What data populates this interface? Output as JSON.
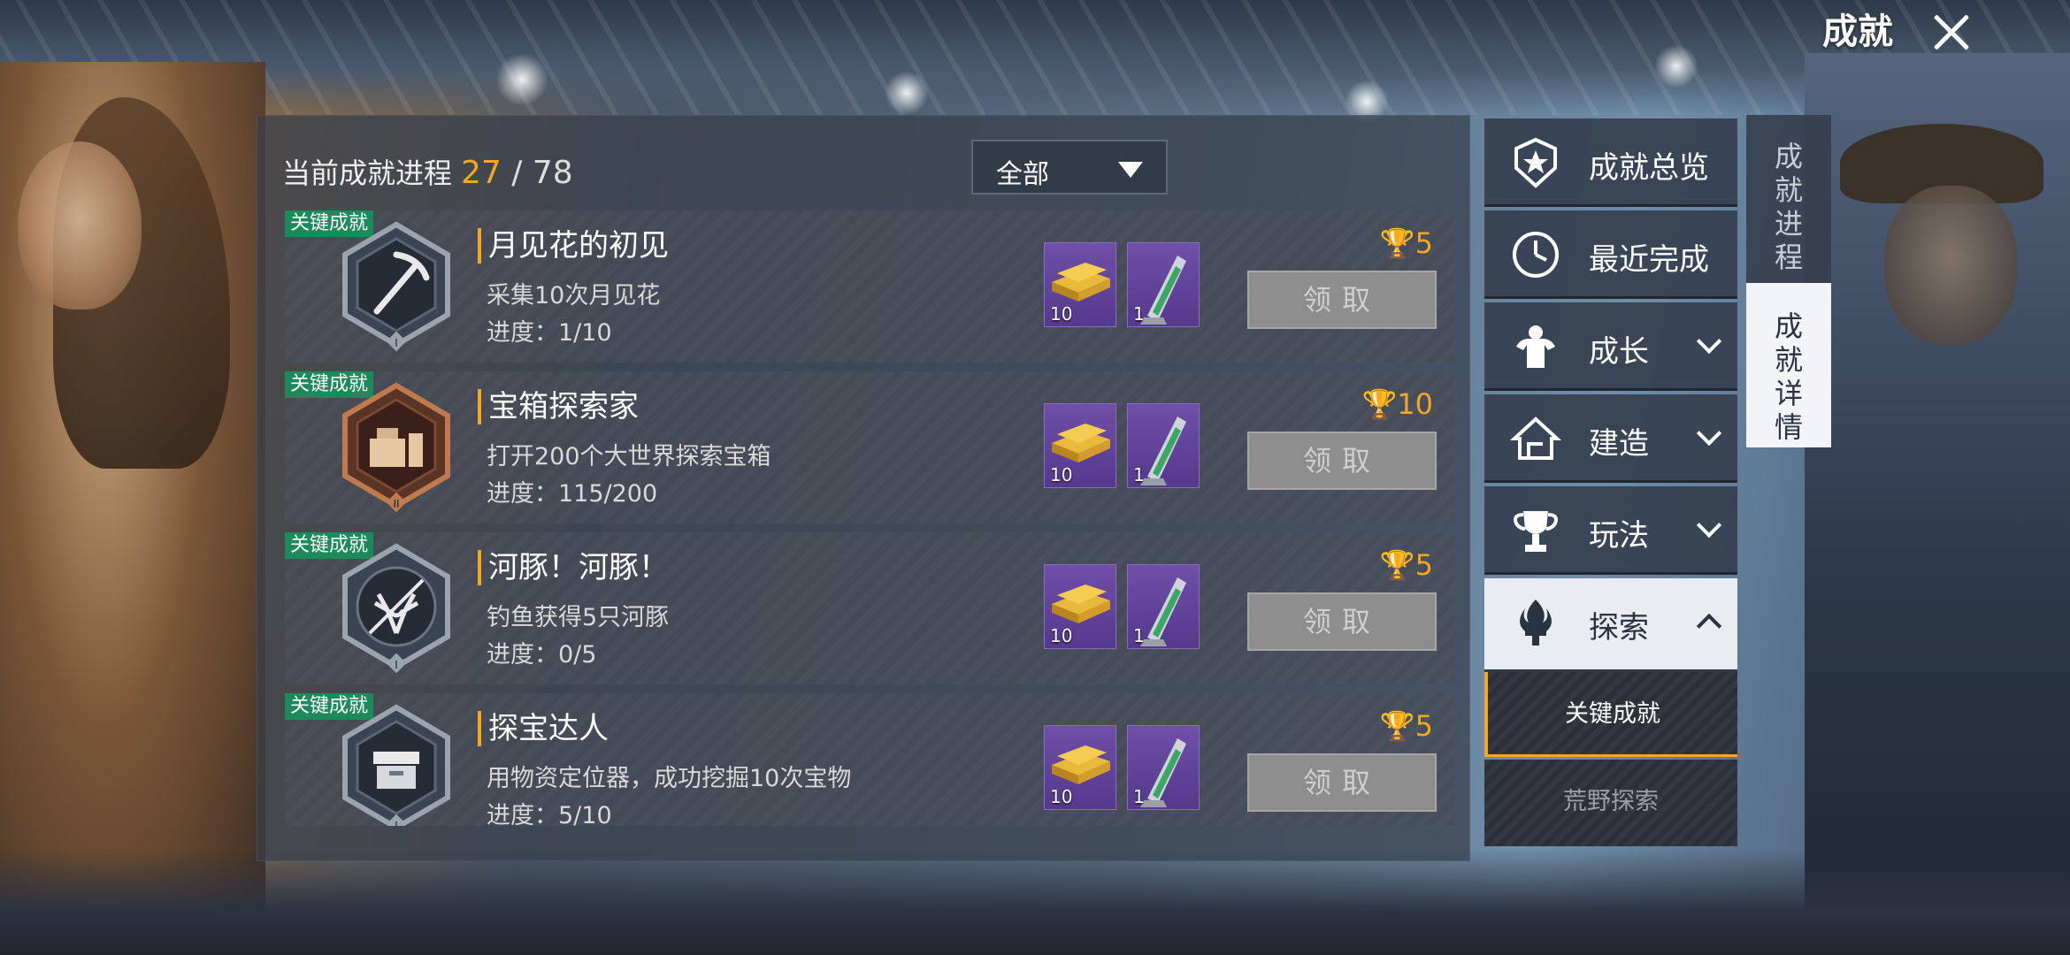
{
  "header": {
    "title": "成就",
    "close_icon": "close-icon"
  },
  "progress": {
    "label": "当前成就进程",
    "current": "27",
    "separator": " / ",
    "total": "78"
  },
  "filter": {
    "selected": "全部",
    "icon": "triangle-down-icon"
  },
  "achievements": [
    {
      "tag": "关键成就",
      "title": "月见花的初见",
      "desc": "采集10次月见花",
      "progress": "进度：1/10",
      "points": "5",
      "reward1_count": "10",
      "reward2_count": "1",
      "claim_label": "领取",
      "badge_icon": "pickaxe-icon",
      "badge_tier": "I"
    },
    {
      "tag": "关键成就",
      "title": "宝箱探索家",
      "desc": "打开200个大世界探索宝箱",
      "progress": "进度：115/200",
      "points": "10",
      "reward1_count": "10",
      "reward2_count": "1",
      "claim_label": "领取",
      "badge_icon": "chest-icon",
      "badge_tier": "II"
    },
    {
      "tag": "关键成就",
      "title": "河豚！河豚！",
      "desc": "钓鱼获得5只河豚",
      "progress": "进度：0/5",
      "points": "5",
      "reward1_count": "10",
      "reward2_count": "1",
      "claim_label": "领取",
      "badge_icon": "deer-icon",
      "badge_tier": "I"
    },
    {
      "tag": "关键成就",
      "title": "探宝达人",
      "desc": "用物资定位器，成功挖掘10次宝物",
      "progress": "进度：5/10",
      "points": "5",
      "reward1_count": "10",
      "reward2_count": "1",
      "claim_label": "领取",
      "badge_icon": "box-icon",
      "badge_tier": "I"
    }
  ],
  "categories": [
    {
      "label": "成就总览",
      "icon": "star-badge-icon"
    },
    {
      "label": "最近完成",
      "icon": "clock-icon"
    },
    {
      "label": "成长",
      "icon": "muscle-icon"
    },
    {
      "label": "建造",
      "icon": "house-icon"
    },
    {
      "label": "玩法",
      "icon": "trophy-icon"
    },
    {
      "label": "探索",
      "icon": "torch-icon"
    }
  ],
  "subcategories": [
    {
      "label": "关键成就"
    },
    {
      "label": "荒野探索"
    }
  ],
  "side_tabs": [
    {
      "label": "成就进程"
    },
    {
      "label": "成就详情"
    }
  ],
  "colors": {
    "accent": "#f5a623",
    "tag_green": "#1c8a5a",
    "reward_purple": "#6f4fa8"
  }
}
